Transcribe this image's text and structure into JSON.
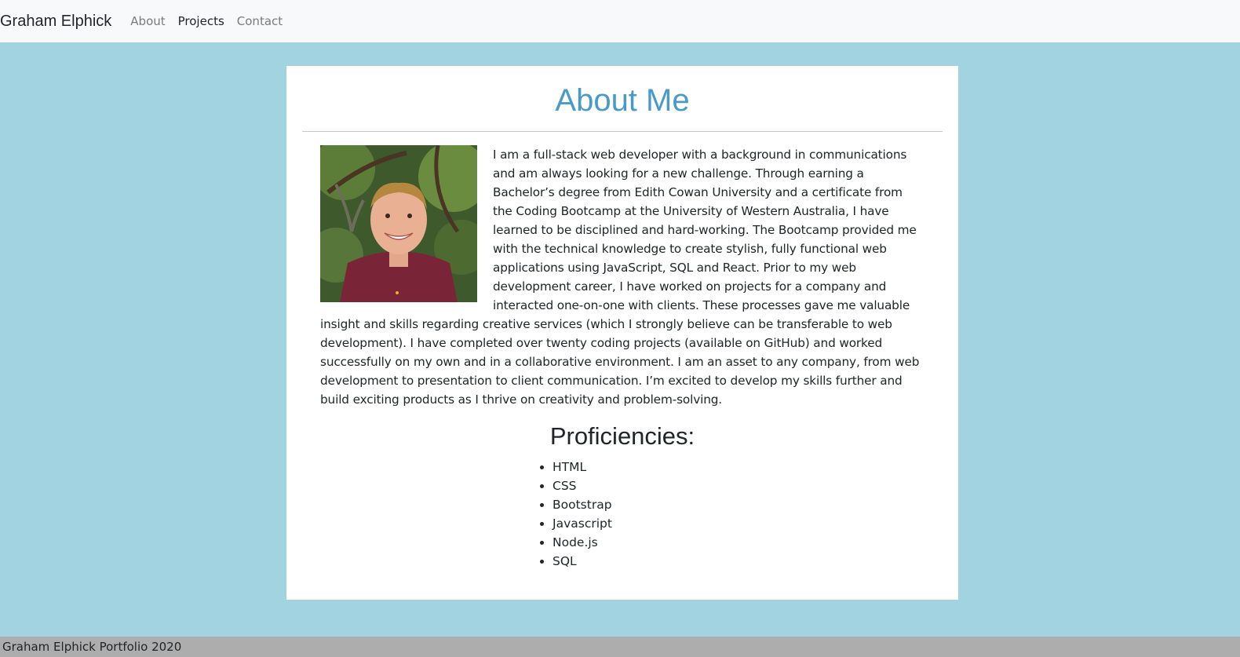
{
  "navbar": {
    "brand": "Graham Elphick",
    "links": [
      {
        "label": "About",
        "active": false
      },
      {
        "label": "Projects",
        "active": true
      },
      {
        "label": "Contact",
        "active": false
      }
    ]
  },
  "about": {
    "title": "About Me",
    "photo_alt": "Portrait photo",
    "bio": "I am a full-stack web developer with a background in communications and am always looking for a new challenge. Through earning a Bachelor’s degree from Edith Cowan University and a certificate from the Coding Bootcamp at the University of Western Australia, I have learned to be disciplined and hard-working. The Bootcamp provided me with the technical knowledge to create stylish, fully functional web applications using JavaScript, SQL and React. Prior to my web development career, I have worked on projects for a company and interacted one-on-one with clients. These processes gave me valuable insight and skills regarding creative services (which I strongly believe can be transferable to web development). I have completed over twenty coding projects (available on GitHub) and worked successfully on my own and in a collaborative environment. I am an asset to any company, from web development to presentation to client communication. I’m excited to develop my skills further and build exciting products as I thrive on creativity and problem-solving."
  },
  "proficiencies": {
    "heading": "Proficiencies:",
    "items": [
      "HTML",
      "CSS",
      "Bootstrap",
      "Javascript",
      "Node.js",
      "SQL"
    ]
  },
  "footer": {
    "text": "Graham Elphick Portfolio 2020"
  },
  "colors": {
    "page_background": "#a2d3e0",
    "navbar_background": "#f8f9fa",
    "title_accent": "#4a9ac9",
    "footer_background": "#adadad"
  }
}
